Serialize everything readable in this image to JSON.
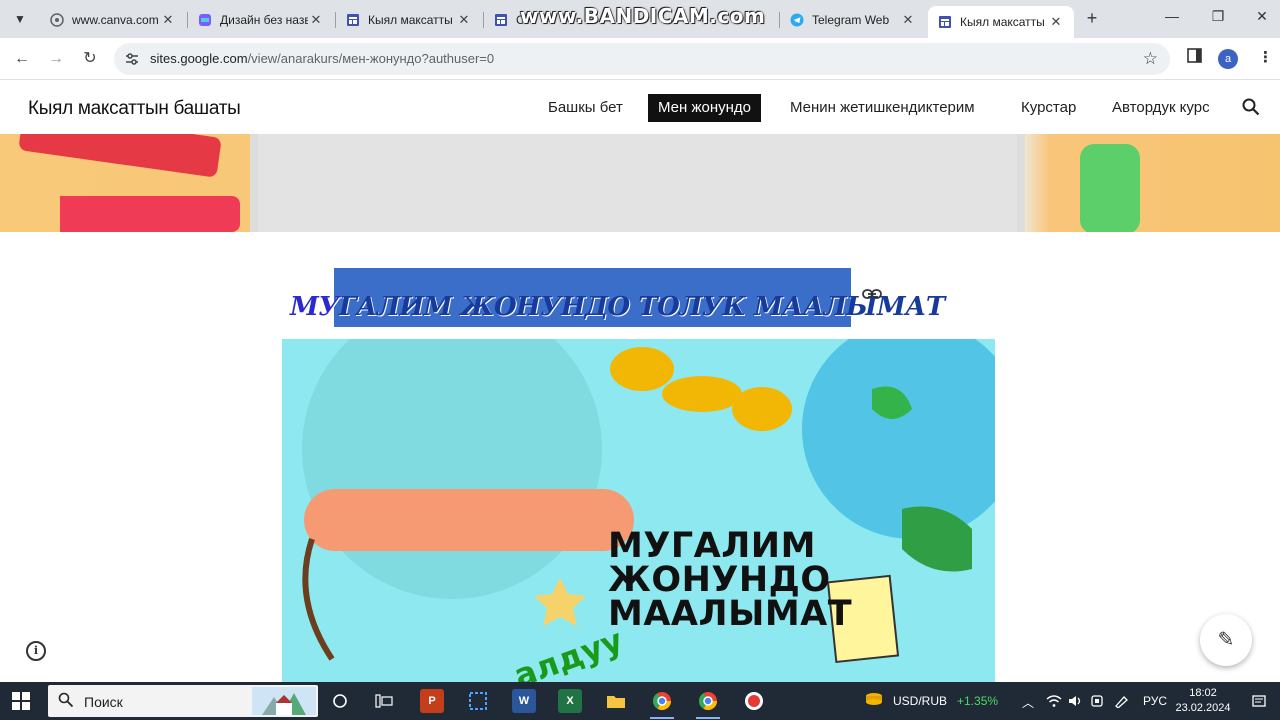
{
  "browser": {
    "tabs": [
      {
        "title": "www.canva.com",
        "favicon": "globe-icon",
        "active": false
      },
      {
        "title": "Дизайн без назв",
        "favicon": "canva-icon",
        "active": false
      },
      {
        "title": "Кыял максатты",
        "favicon": "sites-icon",
        "active": false
      },
      {
        "title": "С",
        "favicon": "sites-icon",
        "active": false
      },
      {
        "title": "Telegram Web",
        "favicon": "telegram-icon",
        "active": false
      },
      {
        "title": "Кыял максатты",
        "favicon": "sites-icon",
        "active": true
      }
    ],
    "new_tab_label": "+",
    "address": {
      "host": "sites.google.com",
      "path": "/view/anarakurs/мен-жонундо?authuser=0"
    },
    "profile_initial": "a"
  },
  "watermark": "www.BANDICAM.com",
  "site": {
    "title": "Кыял максаттын башаты",
    "nav": [
      {
        "label": "Башкы бет",
        "active": false
      },
      {
        "label": "Мен жонундо",
        "active": true
      },
      {
        "label": "Менин жетишкендиктерим",
        "active": false
      },
      {
        "label": "Курстар",
        "active": false
      },
      {
        "label": "Автордук курс",
        "active": false
      }
    ]
  },
  "content": {
    "heading_prefix": "МУ",
    "heading_selected": "ГАЛИМ ЖОНУНДО ТОЛУК МААЛЫМАТ",
    "image_text_lines": [
      "МУГАЛИМ",
      "ЖОНУНДО",
      "МААЛЫМАТ"
    ],
    "image_subtext": "алдуу"
  },
  "taskbar": {
    "search_placeholder": "Поиск",
    "currency_pair": "USD/RUB",
    "currency_change": "+1.35%",
    "language": "РУС",
    "time": "18:02",
    "date": "23.02.2024"
  }
}
